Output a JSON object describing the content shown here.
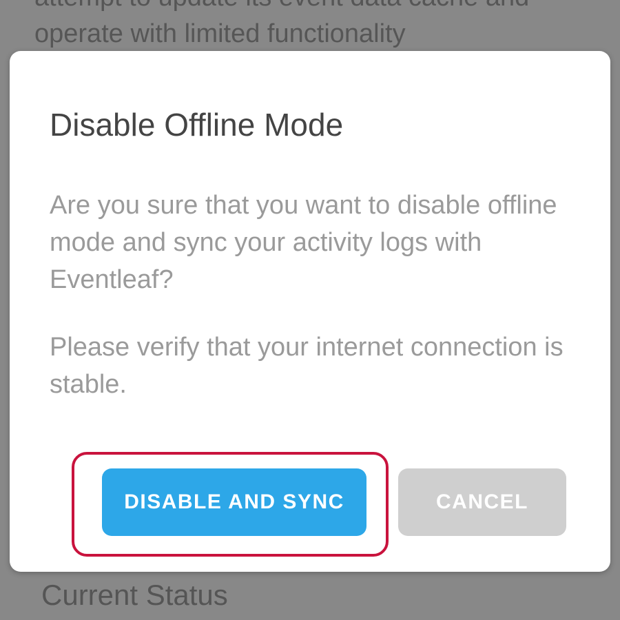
{
  "background": {
    "top_text": "attempt to update its event data cache and operate with limited functionality",
    "bottom_heading": "Current Status"
  },
  "dialog": {
    "title": "Disable Offline Mode",
    "message_p1": "Are you sure that you want to disable offline mode and sync your activity logs with Eventleaf?",
    "message_p2": "Please verify that your internet connection is stable.",
    "primary_button": "DISABLE AND SYNC",
    "secondary_button": "CANCEL"
  }
}
